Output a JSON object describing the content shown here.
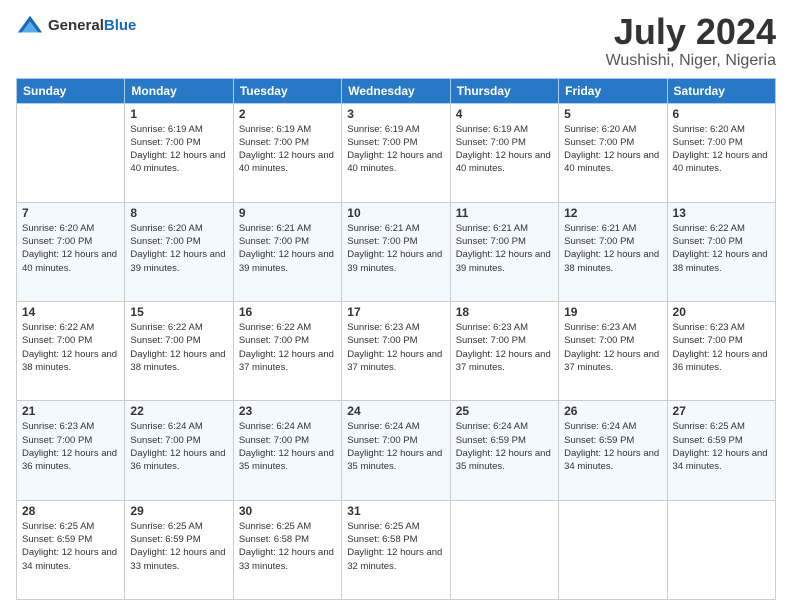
{
  "header": {
    "logo_general": "General",
    "logo_blue": "Blue",
    "month_title": "July 2024",
    "location": "Wushishi, Niger, Nigeria"
  },
  "days_of_week": [
    "Sunday",
    "Monday",
    "Tuesday",
    "Wednesday",
    "Thursday",
    "Friday",
    "Saturday"
  ],
  "weeks": [
    [
      {
        "day": "",
        "sunrise": "",
        "sunset": "",
        "daylight": ""
      },
      {
        "day": "1",
        "sunrise": "Sunrise: 6:19 AM",
        "sunset": "Sunset: 7:00 PM",
        "daylight": "Daylight: 12 hours and 40 minutes."
      },
      {
        "day": "2",
        "sunrise": "Sunrise: 6:19 AM",
        "sunset": "Sunset: 7:00 PM",
        "daylight": "Daylight: 12 hours and 40 minutes."
      },
      {
        "day": "3",
        "sunrise": "Sunrise: 6:19 AM",
        "sunset": "Sunset: 7:00 PM",
        "daylight": "Daylight: 12 hours and 40 minutes."
      },
      {
        "day": "4",
        "sunrise": "Sunrise: 6:19 AM",
        "sunset": "Sunset: 7:00 PM",
        "daylight": "Daylight: 12 hours and 40 minutes."
      },
      {
        "day": "5",
        "sunrise": "Sunrise: 6:20 AM",
        "sunset": "Sunset: 7:00 PM",
        "daylight": "Daylight: 12 hours and 40 minutes."
      },
      {
        "day": "6",
        "sunrise": "Sunrise: 6:20 AM",
        "sunset": "Sunset: 7:00 PM",
        "daylight": "Daylight: 12 hours and 40 minutes."
      }
    ],
    [
      {
        "day": "7",
        "sunrise": "Sunrise: 6:20 AM",
        "sunset": "Sunset: 7:00 PM",
        "daylight": "Daylight: 12 hours and 40 minutes."
      },
      {
        "day": "8",
        "sunrise": "Sunrise: 6:20 AM",
        "sunset": "Sunset: 7:00 PM",
        "daylight": "Daylight: 12 hours and 39 minutes."
      },
      {
        "day": "9",
        "sunrise": "Sunrise: 6:21 AM",
        "sunset": "Sunset: 7:00 PM",
        "daylight": "Daylight: 12 hours and 39 minutes."
      },
      {
        "day": "10",
        "sunrise": "Sunrise: 6:21 AM",
        "sunset": "Sunset: 7:00 PM",
        "daylight": "Daylight: 12 hours and 39 minutes."
      },
      {
        "day": "11",
        "sunrise": "Sunrise: 6:21 AM",
        "sunset": "Sunset: 7:00 PM",
        "daylight": "Daylight: 12 hours and 39 minutes."
      },
      {
        "day": "12",
        "sunrise": "Sunrise: 6:21 AM",
        "sunset": "Sunset: 7:00 PM",
        "daylight": "Daylight: 12 hours and 38 minutes."
      },
      {
        "day": "13",
        "sunrise": "Sunrise: 6:22 AM",
        "sunset": "Sunset: 7:00 PM",
        "daylight": "Daylight: 12 hours and 38 minutes."
      }
    ],
    [
      {
        "day": "14",
        "sunrise": "Sunrise: 6:22 AM",
        "sunset": "Sunset: 7:00 PM",
        "daylight": "Daylight: 12 hours and 38 minutes."
      },
      {
        "day": "15",
        "sunrise": "Sunrise: 6:22 AM",
        "sunset": "Sunset: 7:00 PM",
        "daylight": "Daylight: 12 hours and 38 minutes."
      },
      {
        "day": "16",
        "sunrise": "Sunrise: 6:22 AM",
        "sunset": "Sunset: 7:00 PM",
        "daylight": "Daylight: 12 hours and 37 minutes."
      },
      {
        "day": "17",
        "sunrise": "Sunrise: 6:23 AM",
        "sunset": "Sunset: 7:00 PM",
        "daylight": "Daylight: 12 hours and 37 minutes."
      },
      {
        "day": "18",
        "sunrise": "Sunrise: 6:23 AM",
        "sunset": "Sunset: 7:00 PM",
        "daylight": "Daylight: 12 hours and 37 minutes."
      },
      {
        "day": "19",
        "sunrise": "Sunrise: 6:23 AM",
        "sunset": "Sunset: 7:00 PM",
        "daylight": "Daylight: 12 hours and 37 minutes."
      },
      {
        "day": "20",
        "sunrise": "Sunrise: 6:23 AM",
        "sunset": "Sunset: 7:00 PM",
        "daylight": "Daylight: 12 hours and 36 minutes."
      }
    ],
    [
      {
        "day": "21",
        "sunrise": "Sunrise: 6:23 AM",
        "sunset": "Sunset: 7:00 PM",
        "daylight": "Daylight: 12 hours and 36 minutes."
      },
      {
        "day": "22",
        "sunrise": "Sunrise: 6:24 AM",
        "sunset": "Sunset: 7:00 PM",
        "daylight": "Daylight: 12 hours and 36 minutes."
      },
      {
        "day": "23",
        "sunrise": "Sunrise: 6:24 AM",
        "sunset": "Sunset: 7:00 PM",
        "daylight": "Daylight: 12 hours and 35 minutes."
      },
      {
        "day": "24",
        "sunrise": "Sunrise: 6:24 AM",
        "sunset": "Sunset: 7:00 PM",
        "daylight": "Daylight: 12 hours and 35 minutes."
      },
      {
        "day": "25",
        "sunrise": "Sunrise: 6:24 AM",
        "sunset": "Sunset: 6:59 PM",
        "daylight": "Daylight: 12 hours and 35 minutes."
      },
      {
        "day": "26",
        "sunrise": "Sunrise: 6:24 AM",
        "sunset": "Sunset: 6:59 PM",
        "daylight": "Daylight: 12 hours and 34 minutes."
      },
      {
        "day": "27",
        "sunrise": "Sunrise: 6:25 AM",
        "sunset": "Sunset: 6:59 PM",
        "daylight": "Daylight: 12 hours and 34 minutes."
      }
    ],
    [
      {
        "day": "28",
        "sunrise": "Sunrise: 6:25 AM",
        "sunset": "Sunset: 6:59 PM",
        "daylight": "Daylight: 12 hours and 34 minutes."
      },
      {
        "day": "29",
        "sunrise": "Sunrise: 6:25 AM",
        "sunset": "Sunset: 6:59 PM",
        "daylight": "Daylight: 12 hours and 33 minutes."
      },
      {
        "day": "30",
        "sunrise": "Sunrise: 6:25 AM",
        "sunset": "Sunset: 6:58 PM",
        "daylight": "Daylight: 12 hours and 33 minutes."
      },
      {
        "day": "31",
        "sunrise": "Sunrise: 6:25 AM",
        "sunset": "Sunset: 6:58 PM",
        "daylight": "Daylight: 12 hours and 32 minutes."
      },
      {
        "day": "",
        "sunrise": "",
        "sunset": "",
        "daylight": ""
      },
      {
        "day": "",
        "sunrise": "",
        "sunset": "",
        "daylight": ""
      },
      {
        "day": "",
        "sunrise": "",
        "sunset": "",
        "daylight": ""
      }
    ]
  ]
}
